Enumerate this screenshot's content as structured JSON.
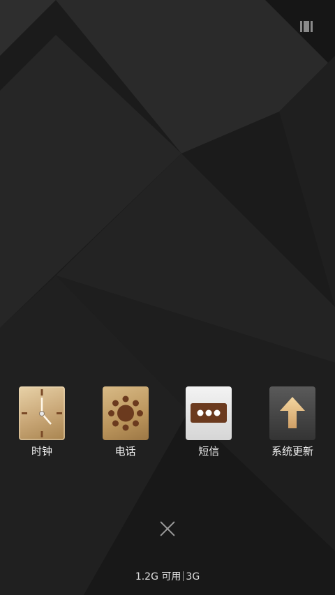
{
  "apps": [
    {
      "label": "时钟",
      "icon": "clock-icon"
    },
    {
      "label": "电话",
      "icon": "phone-icon"
    },
    {
      "label": "短信",
      "icon": "sms-icon"
    },
    {
      "label": "系统更新",
      "icon": "update-icon"
    }
  ],
  "status": {
    "memory_available": "1.2G 可用",
    "network": "3G"
  },
  "controls": {
    "close_icon": "close-icon",
    "top_right_icon": "recent-apps-icon"
  },
  "colors": {
    "background": "#1c1c1c",
    "gold": "#c8a676",
    "brown": "#6b3a1e"
  }
}
